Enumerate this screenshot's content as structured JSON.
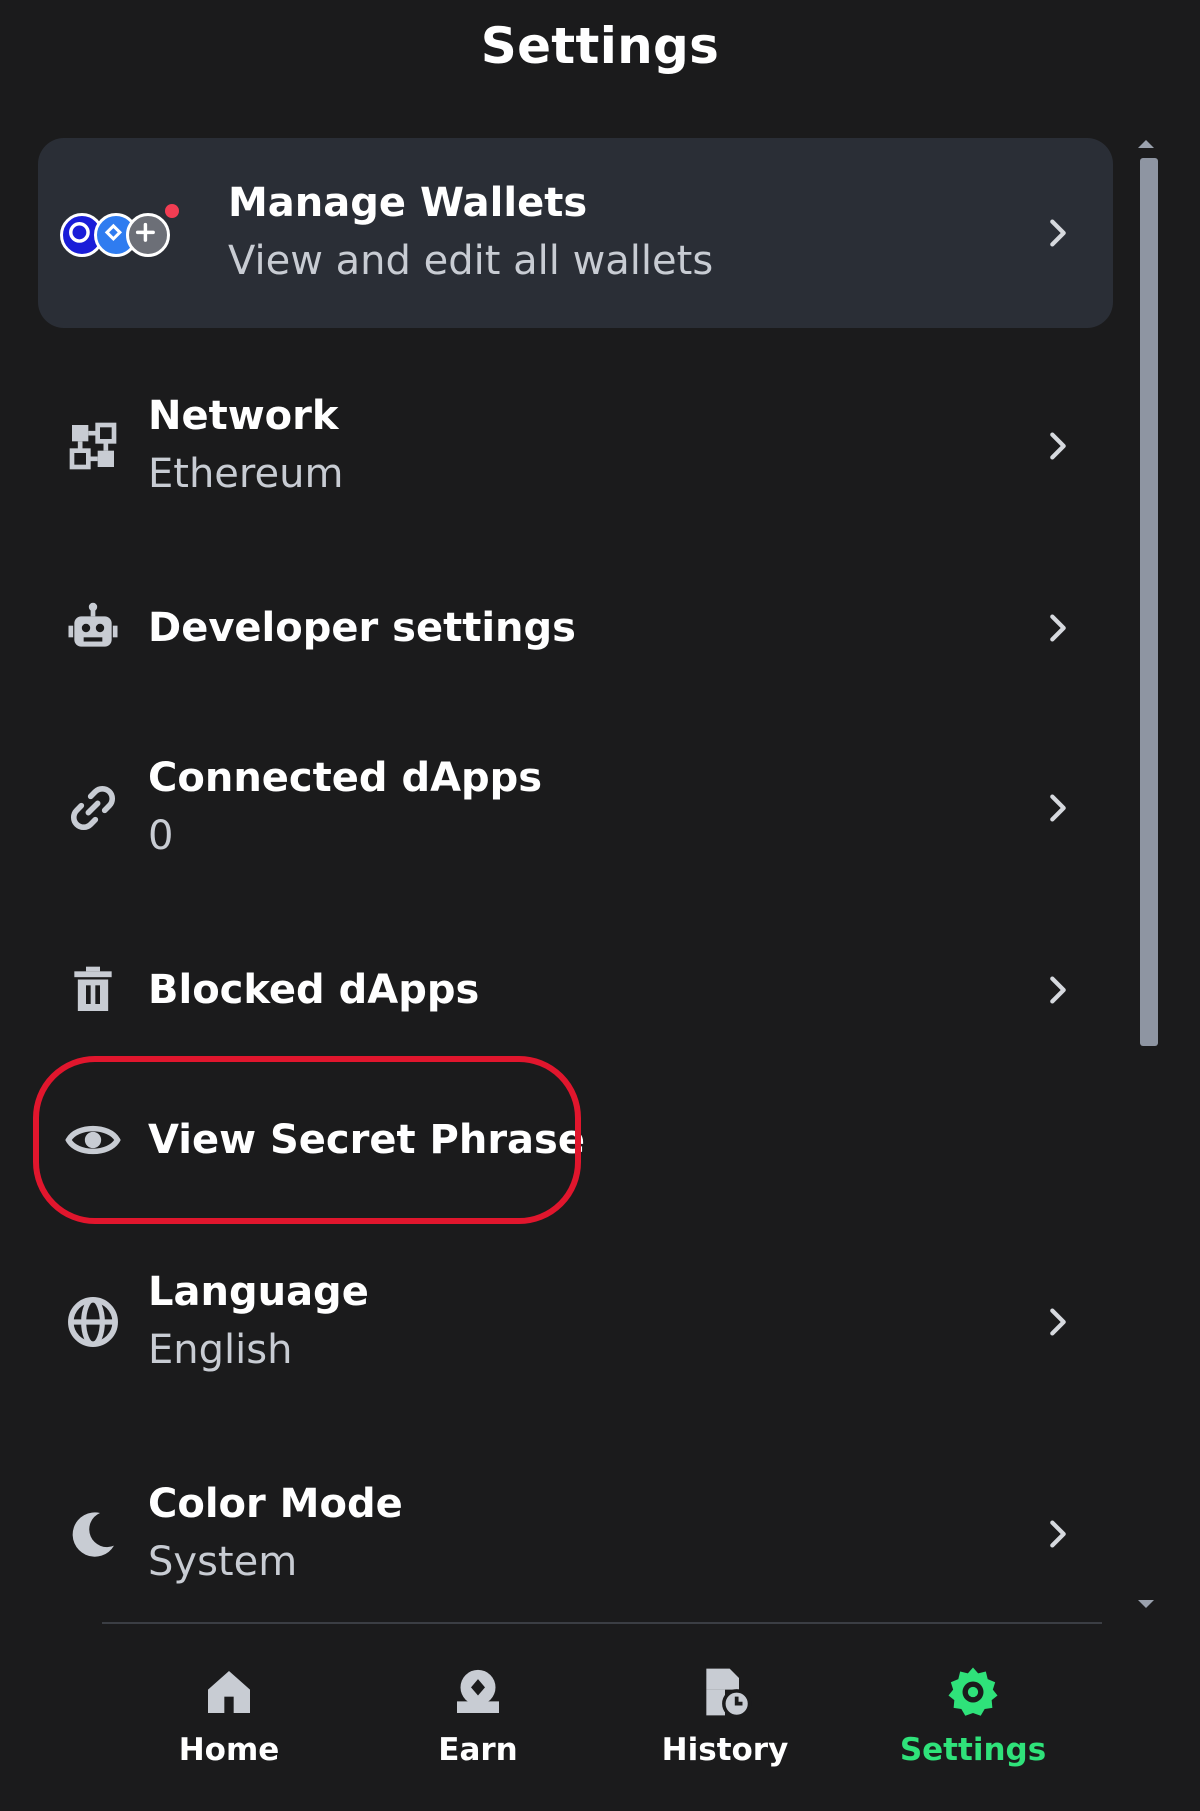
{
  "header": {
    "title": "Settings"
  },
  "manage_wallets": {
    "title": "Manage Wallets",
    "subtitle": "View and edit all wallets",
    "icons": [
      "wallet-c-icon",
      "wallet-diamond-icon",
      "plus-icon"
    ],
    "dot_color": "#f23d53"
  },
  "items": [
    {
      "key": "network",
      "icon": "network-icon",
      "label": "Network",
      "sub": "Ethereum"
    },
    {
      "key": "developer",
      "icon": "robot-icon",
      "label": "Developer settings",
      "sub": ""
    },
    {
      "key": "connected",
      "icon": "link-icon",
      "label": "Connected dApps",
      "sub": "0"
    },
    {
      "key": "blocked",
      "icon": "trash-icon",
      "label": "Blocked dApps",
      "sub": ""
    },
    {
      "key": "secret",
      "icon": "eye-icon",
      "label": "View Secret Phrase",
      "sub": ""
    },
    {
      "key": "language",
      "icon": "globe-icon",
      "label": "Language",
      "sub": "English"
    },
    {
      "key": "color",
      "icon": "moon-icon",
      "label": "Color Mode",
      "sub": "System"
    }
  ],
  "nav": [
    {
      "key": "home",
      "icon": "home-icon",
      "label": "Home"
    },
    {
      "key": "earn",
      "icon": "earn-icon",
      "label": "Earn"
    },
    {
      "key": "history",
      "icon": "history-icon",
      "label": "History"
    },
    {
      "key": "settings",
      "icon": "gear-icon",
      "label": "Settings",
      "active": true
    }
  ],
  "colors": {
    "background": "#1b1b1c",
    "card": "#2a2e36",
    "highlight": "#e1162d",
    "active": "#2fe27a",
    "icon": "#c8ccd3"
  }
}
